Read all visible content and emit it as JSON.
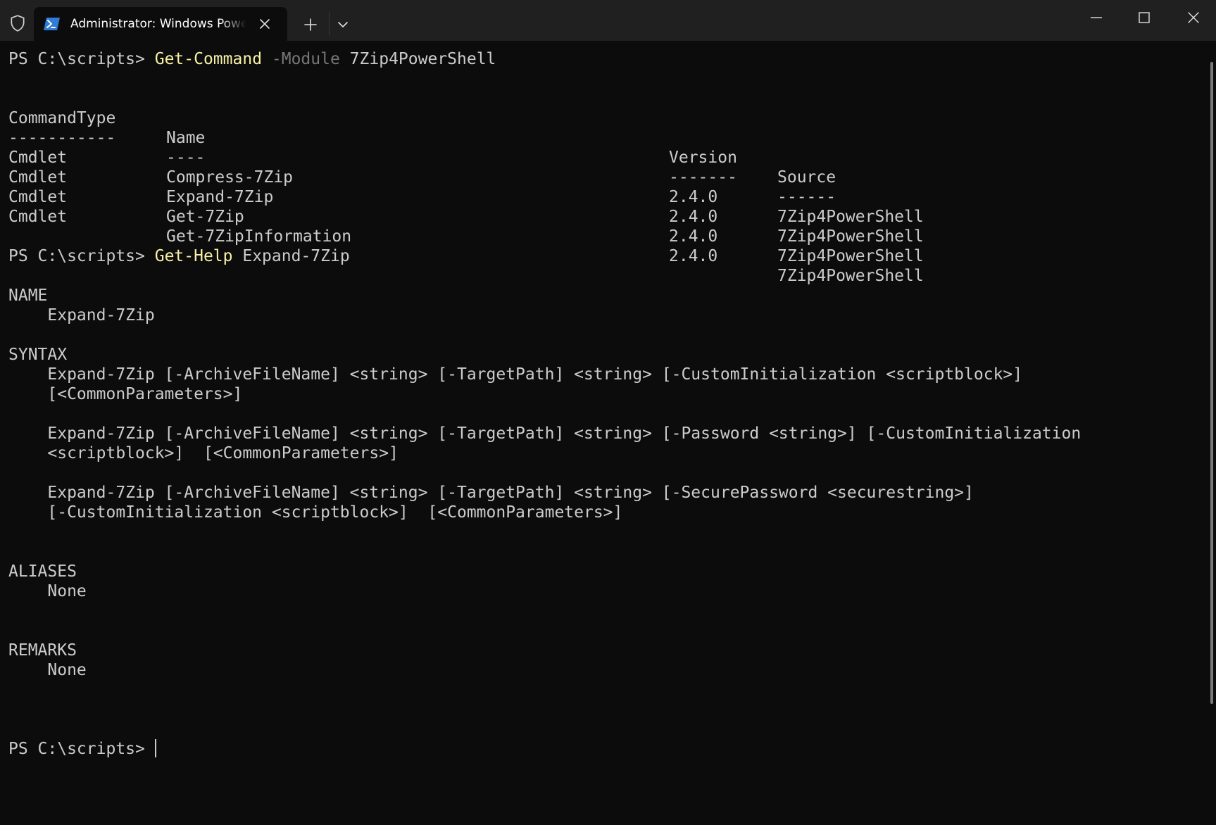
{
  "window": {
    "tab_title": "Administrator: Windows PowerShell",
    "icons": [
      "shield-icon",
      "powershell-icon",
      "close-icon",
      "plus-icon",
      "chevron-down-icon",
      "minimize-icon",
      "maximize-icon",
      "close-icon"
    ]
  },
  "terminal": {
    "cmd1": {
      "prompt": "PS C:\\scripts> ",
      "command": "Get-Command",
      "param": " -Module",
      "arg": " 7Zip4PowerShell"
    },
    "table": {
      "headers": [
        "CommandType",
        "Name",
        "Version",
        "Source"
      ],
      "underlines": [
        "-----------",
        "----",
        "-------",
        "------"
      ],
      "rows": [
        [
          "Cmdlet",
          "Compress-7Zip",
          "2.4.0",
          "7Zip4PowerShell"
        ],
        [
          "Cmdlet",
          "Expand-7Zip",
          "2.4.0",
          "7Zip4PowerShell"
        ],
        [
          "Cmdlet",
          "Get-7Zip",
          "2.4.0",
          "7Zip4PowerShell"
        ],
        [
          "Cmdlet",
          "Get-7ZipInformation",
          "2.4.0",
          "7Zip4PowerShell"
        ]
      ]
    },
    "cmd2": {
      "prompt": "PS C:\\scripts> ",
      "command": "Get-Help",
      "arg": " Expand-7Zip"
    },
    "help": {
      "name_heading": "NAME",
      "name_value": "    Expand-7Zip",
      "syntax_heading": "SYNTAX",
      "syntax_lines": [
        "    Expand-7Zip [-ArchiveFileName] <string> [-TargetPath] <string> [-CustomInitialization <scriptblock>]",
        "    [<CommonParameters>]",
        "    Expand-7Zip [-ArchiveFileName] <string> [-TargetPath] <string> [-Password <string>] [-CustomInitialization",
        "    <scriptblock>]  [<CommonParameters>]",
        "    Expand-7Zip [-ArchiveFileName] <string> [-TargetPath] <string> [-SecurePassword <securestring>]",
        "    [-CustomInitialization <scriptblock>]  [<CommonParameters>]"
      ],
      "aliases_heading": "ALIASES",
      "aliases_value": "    None",
      "remarks_heading": "REMARKS",
      "remarks_value": "    None"
    },
    "final_prompt": "PS C:\\scripts> ",
    "colors": {
      "background": "#0c0c0c",
      "text": "#cccccc",
      "command": "#f9f1a5",
      "parameter": "#767676"
    }
  }
}
